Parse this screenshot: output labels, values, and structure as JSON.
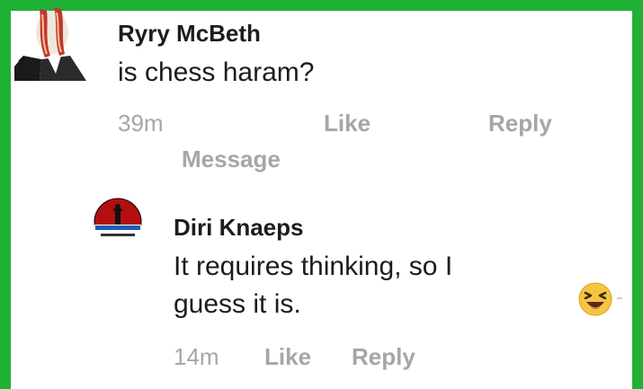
{
  "comments": [
    {
      "author": "Ryry McBeth",
      "text": "is chess haram?",
      "time": "39m",
      "like_label": "Like",
      "reply_label": "Reply",
      "message_label": "Message"
    },
    {
      "author": "Diri Knaeps",
      "text_line1": "It requires thinking, so I",
      "text_line2": "guess it is.",
      "time": "14m",
      "like_label": "Like",
      "reply_label": "Reply",
      "reaction_icon": "laughing-emoji-icon"
    }
  ],
  "colors": {
    "frame": "#1fb036",
    "meta_text": "#a6a6a6",
    "body_text": "#1c1c1c",
    "emoji": "#f5c542"
  }
}
